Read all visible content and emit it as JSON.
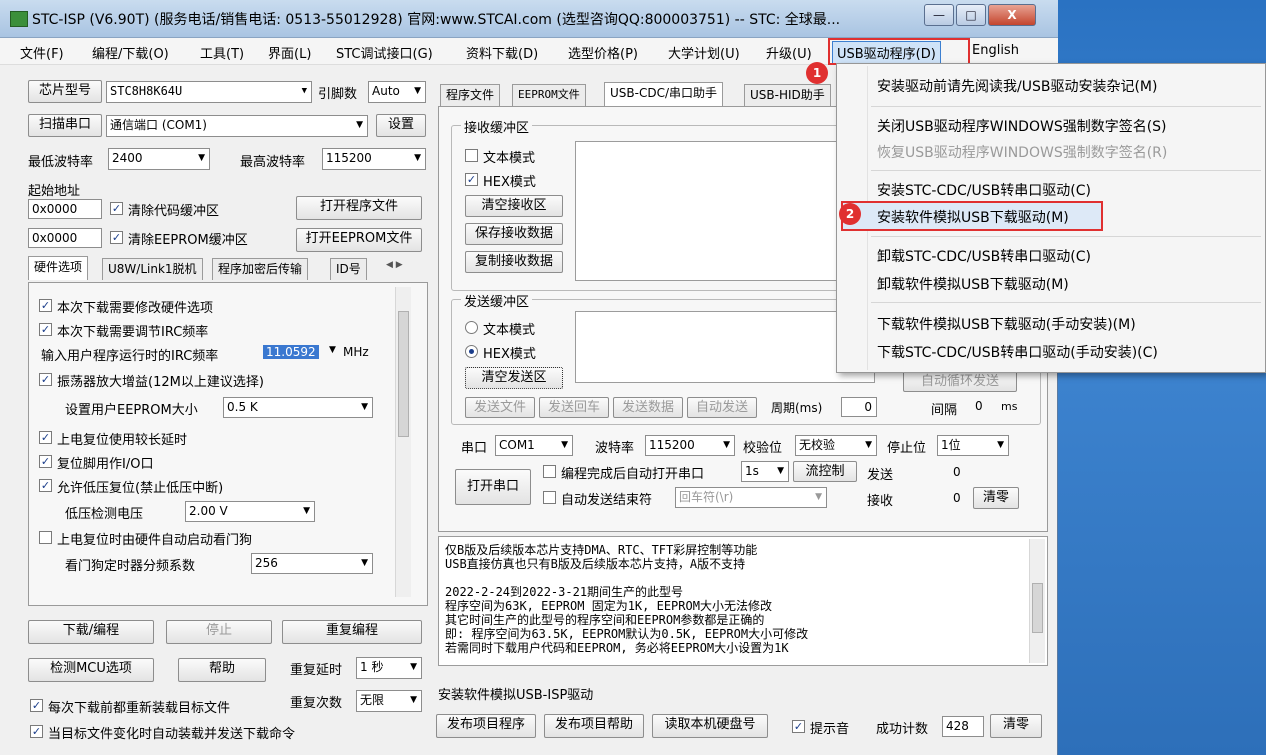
{
  "window": {
    "title": "STC-ISP (V6.90T) (服务电话/销售电话: 0513-55012928) 官网:www.STCAI.com  (选型咨询QQ:800003751) -- STC: 全球最...",
    "min": "—",
    "max": "□",
    "close": "X"
  },
  "menubar": {
    "items": [
      "文件(F)",
      "编程/下载(O)",
      "工具(T)",
      "界面(L)",
      "STC调试接口(G)",
      "资料下载(D)",
      "选型价格(P)",
      "大学计划(U)",
      "升级(U)",
      "USB驱动程序(D)",
      "English"
    ]
  },
  "badges": {
    "b1": "1",
    "b2": "2"
  },
  "left": {
    "chip_btn": "芯片型号",
    "chip_value": "STC8H8K64U",
    "pin_label": "引脚数",
    "pin_value": "Auto",
    "scan_btn": "扫描串口",
    "port_value": "通信端口 (COM1)",
    "settings_btn": "设置",
    "min_baud_label": "最低波特率",
    "min_baud": "2400",
    "max_baud_label": "最高波特率",
    "max_baud": "115200",
    "start_addr_label": "起始地址",
    "addr1": "0x0000",
    "clear_code": "清除代码缓冲区",
    "open_prog_btn": "打开程序文件",
    "addr2": "0x0000",
    "clear_eeprom": "清除EEPROM缓冲区",
    "open_eeprom_btn": "打开EEPROM文件",
    "tabs": [
      "硬件选项",
      "U8W/Link1脱机",
      "程序加密后传输",
      "ID号"
    ],
    "options": {
      "o1": "本次下载需要修改硬件选项",
      "o2": "本次下载需要调节IRC频率",
      "irc_label": "输入用户程序运行时的IRC频率",
      "irc_value": "11.0592",
      "irc_unit": "MHz",
      "o3": "振荡器放大增益(12M以上建议选择)",
      "eeprom_size_label": "设置用户EEPROM大小",
      "eeprom_size": "0.5 K",
      "o4": "上电复位使用较长延时",
      "o5": "复位脚用作I/O口",
      "o6": "允许低压复位(禁止低压中断)",
      "lv_label": "低压检测电压",
      "lv_value": "2.00 V",
      "o7": "上电复位时由硬件自动启动看门狗",
      "wdt_label": "看门狗定时器分频系数",
      "wdt_value": "256"
    },
    "download_btn": "下载/编程",
    "stop_btn": "停止",
    "reprogram_btn": "重复编程",
    "detect_btn": "检测MCU选项",
    "help_btn": "帮助",
    "repeat_delay_label": "重复延时",
    "repeat_delay": "1 秒",
    "repeat_count_label": "重复次数",
    "repeat_count": "无限",
    "reload_each": "每次下载前都重新装载目标文件",
    "auto_send": "当目标文件变化时自动装载并发送下载命令"
  },
  "right": {
    "tabs": [
      "程序文件",
      "EEPROM文件",
      "USB-CDC/串口助手",
      "USB-HID助手"
    ],
    "recv_group": "接收缓冲区",
    "text_mode": "文本模式",
    "hex_mode": "HEX模式",
    "clear_recv": "清空接收区",
    "save_recv": "保存接收数据",
    "copy_recv": "复制接收数据",
    "send_group": "发送缓冲区",
    "send_text_mode": "文本模式",
    "send_hex_mode": "HEX模式",
    "clear_send": "清空发送区",
    "auto_loop": "自动循环发送",
    "interval_label": "间隔",
    "interval_value": "0",
    "interval_unit": "ms",
    "send_file": "发送文件",
    "send_cr": "发送回车",
    "send_data": "发送数据",
    "auto_send": "自动发送",
    "period_label": "周期(ms)",
    "period_value": "0",
    "port_label": "串口",
    "port_value": "COM1",
    "baud_label": "波特率",
    "baud_value": "115200",
    "parity_label": "校验位",
    "parity_value": "无校验",
    "stop_label": "停止位",
    "stop_value": "1位",
    "open_port": "打开串口",
    "auto_open": "编程完成后自动打开串口",
    "delay_value": "1s",
    "flow_ctrl": "流控制",
    "send_count_label": "发送",
    "send_count": "0",
    "auto_end": "自动发送结束符",
    "end_char": "回车符(\\r)",
    "recv_count_label": "接收",
    "recv_count": "0",
    "clear_count": "清零",
    "info_lines": [
      "仅B版及后续版本芯片支持DMA、RTC、TFT彩屏控制等功能",
      "USB直接仿真也只有B版及后续版本芯片支持，A版不支持",
      "",
      "2022-2-24到2022-3-21期间生产的此型号",
      "程序空间为63K, EEPROM 固定为1K, EEPROM大小无法修改",
      "其它时间生产的此型号的程序空间和EEPROM参数都是正确的",
      "即: 程序空间为63.5K, EEPROM默认为0.5K, EEPROM大小可修改",
      "若需同时下载用户代码和EEPROM, 务必将EEPROM大小设置为1K"
    ],
    "status_text": "安装软件模拟USB-ISP驱动",
    "publish_prog": "发布项目程序",
    "publish_help": "发布项目帮助",
    "read_disk": "读取本机硬盘号",
    "beep": "提示音",
    "success_label": "成功计数",
    "success_count": "428",
    "clear_btn": "清零"
  },
  "dropdown": {
    "items": [
      "安装驱动前请先阅读我/USB驱动安装杂记(M)",
      "关闭USB驱动程序WINDOWS强制数字签名(S)",
      "恢复USB驱动程序WINDOWS强制数字签名(R)",
      "安装STC-CDC/USB转串口驱动(C)",
      "安装软件模拟USB下载驱动(M)",
      "卸载STC-CDC/USB转串口驱动(C)",
      "卸载软件模拟USB下载驱动(M)",
      "下载软件模拟USB下载驱动(手动安装)(M)",
      "下载STC-CDC/USB转串口驱动(手动安装)(C)"
    ]
  }
}
